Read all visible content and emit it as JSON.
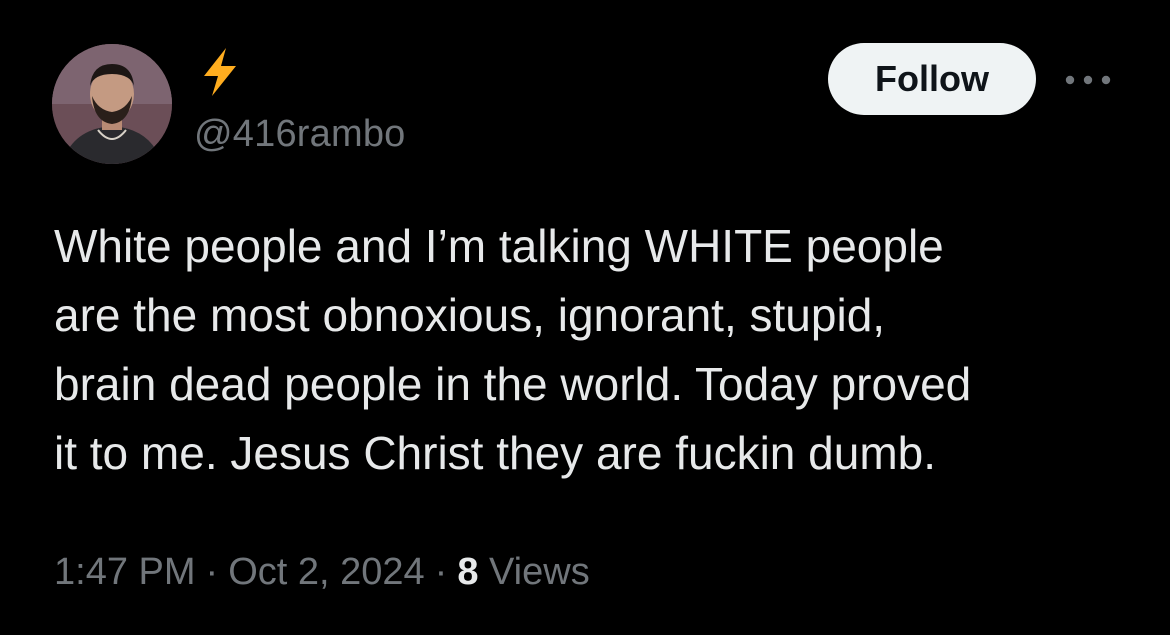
{
  "author": {
    "display_name_icon": "lightning-bolt-icon",
    "handle": "@416rambo",
    "avatar_icon": "profile-photo"
  },
  "actions": {
    "follow_label": "Follow",
    "more_icon": "more-options-icon"
  },
  "tweet": {
    "text": "White people and I’m talking WHITE people\nare the most obnoxious, ignorant, stupid,\nbrain dead people in the world. Today proved\nit to me. Jesus Christ they are fuckin dumb."
  },
  "meta": {
    "time": "1:47 PM",
    "separator": "·",
    "date": "Oct 2, 2024",
    "views_count": "8",
    "views_label": "Views"
  },
  "colors": {
    "background": "#000000",
    "text_primary": "#e7e9ea",
    "text_secondary": "#71767b",
    "follow_bg": "#eff3f4",
    "lightning": "#ffad1f"
  }
}
